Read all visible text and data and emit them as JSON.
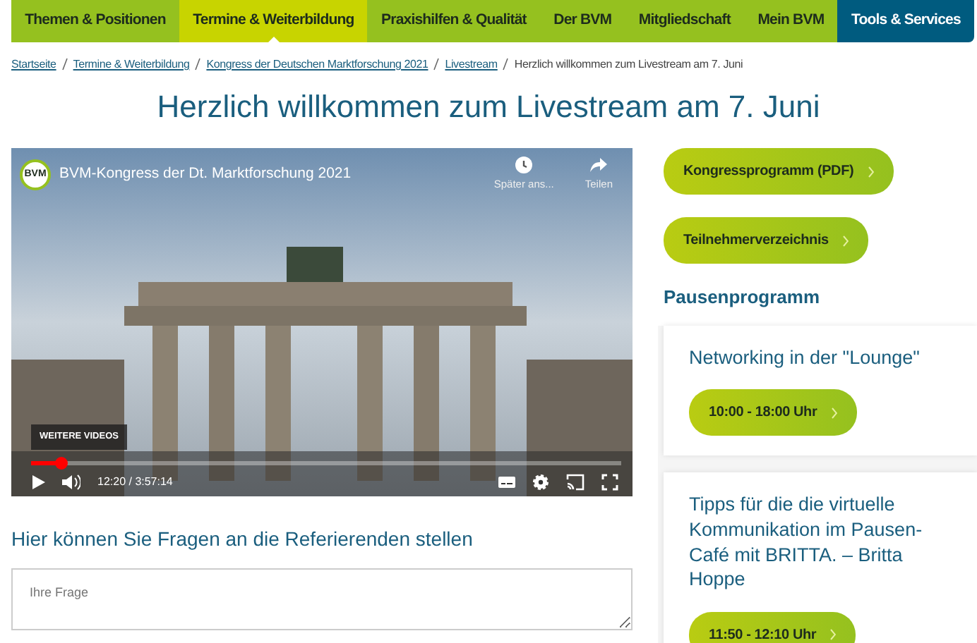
{
  "nav": [
    {
      "label": "Themen & Positionen",
      "selected": false,
      "kind": "main"
    },
    {
      "label": "Termine & Weiterbildung",
      "selected": true,
      "kind": "main"
    },
    {
      "label": "Praxishilfen & Qualität",
      "selected": false,
      "kind": "main"
    },
    {
      "label": "Der BVM",
      "selected": false,
      "kind": "main"
    },
    {
      "label": "Mitgliedschaft",
      "selected": false,
      "kind": "main"
    },
    {
      "label": "Mein BVM",
      "selected": false,
      "kind": "main"
    },
    {
      "label": "Tools & Services",
      "selected": false,
      "kind": "tools"
    }
  ],
  "breadcrumb": {
    "links": [
      "Startseite",
      "Termine & Weiterbildung",
      "Kongress der Deutschen Marktforschung 2021",
      "Livestream"
    ],
    "current": "Herzlich willkommen zum Livestream am 7. Juni"
  },
  "title": "Herzlich willkommen zum Livestream am 7. Juni",
  "video": {
    "logo": "BVM",
    "title": "BVM-Kongress der Dt. Marktforschung 2021",
    "watch_later": "Später ans...",
    "share": "Teilen",
    "more_videos": "WEITERE VIDEOS",
    "time": "12:20 / 3:57:14",
    "progress": {
      "level": 0.05
    }
  },
  "question": {
    "heading": "Hier können Sie Fragen an die Referierenden stellen",
    "placeholder": "Ihre Frage"
  },
  "side_buttons": [
    "Kongressprogramm (PDF)",
    "Teilnehmerverzeichnis"
  ],
  "break_heading": "Pausenprogramm",
  "break_items": [
    {
      "title": "Networking in der \"Lounge\"",
      "time": "10:00 - 18:00 Uhr"
    },
    {
      "title": "Tipps für die die virtuelle Kommunikation im Pausen-Café mit BRITTA. – Britta Hoppe",
      "time": "11:50 - 12:10 Uhr"
    }
  ]
}
